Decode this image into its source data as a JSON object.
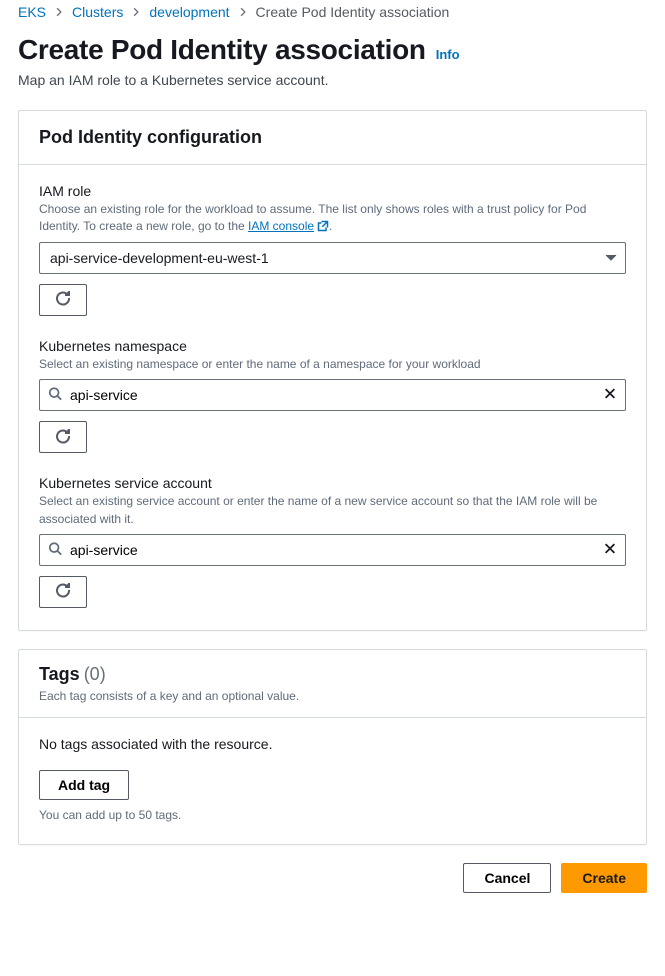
{
  "breadcrumb": {
    "eks": "EKS",
    "clusters": "Clusters",
    "development": "development",
    "current": "Create Pod Identity association"
  },
  "header": {
    "title": "Create Pod Identity association",
    "info": "Info",
    "subtitle": "Map an IAM role to a Kubernetes service account."
  },
  "config": {
    "panel_title": "Pod Identity configuration",
    "iam_role": {
      "label": "IAM role",
      "desc_prefix": "Choose an existing role for the workload to assume. The list only shows roles with a trust policy for Pod Identity. To create a new role, go to the ",
      "desc_link": "IAM console",
      "desc_suffix": ".",
      "value": "api-service-development-eu-west-1"
    },
    "namespace": {
      "label": "Kubernetes namespace",
      "desc": "Select an existing namespace or enter the name of a namespace for your workload",
      "value": "api-service"
    },
    "service_account": {
      "label": "Kubernetes service account",
      "desc": "Select an existing service account or enter the name of a new service account so that the IAM role will be associated with it.",
      "value": "api-service"
    }
  },
  "tags": {
    "title": "Tags",
    "count": "(0)",
    "subtitle": "Each tag consists of a key and an optional value.",
    "empty": "No tags associated with the resource.",
    "add_label": "Add tag",
    "limit": "You can add up to 50 tags."
  },
  "footer": {
    "cancel": "Cancel",
    "create": "Create"
  }
}
